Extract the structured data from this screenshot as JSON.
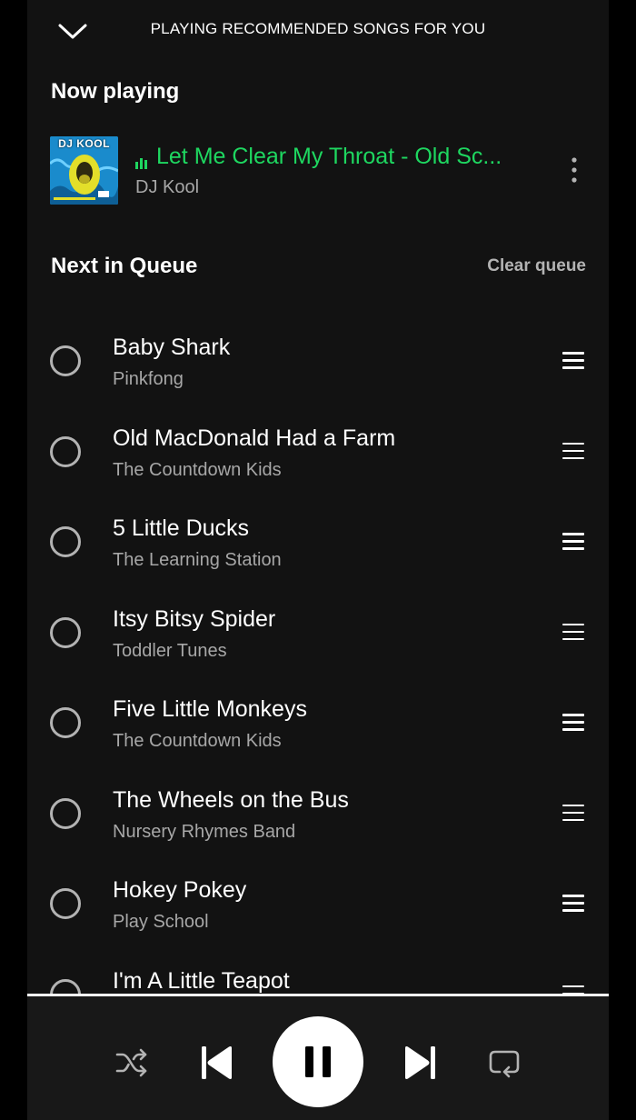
{
  "header": {
    "title": "PLAYING RECOMMENDED SONGS FOR YOU",
    "collapse_icon": "chevron-down-icon"
  },
  "now_playing": {
    "heading": "Now playing",
    "track": {
      "title": "Let Me Clear My Throat - Old Sc...",
      "artist": "DJ Kool",
      "art_text": "DJ KOOL",
      "playing_indicator_icon": "equalizer-icon",
      "more_icon": "more-vertical-icon"
    }
  },
  "queue": {
    "heading": "Next in Queue",
    "clear_label": "Clear queue",
    "items": [
      {
        "title": "Baby Shark",
        "artist": "Pinkfong"
      },
      {
        "title": "Old MacDonald Had a Farm",
        "artist": "The Countdown Kids"
      },
      {
        "title": "5 Little Ducks",
        "artist": "The Learning Station"
      },
      {
        "title": "Itsy Bitsy Spider",
        "artist": "Toddler Tunes"
      },
      {
        "title": "Five Little Monkeys",
        "artist": "The Countdown Kids"
      },
      {
        "title": "The Wheels on the Bus",
        "artist": "Nursery Rhymes Band"
      },
      {
        "title": "Hokey Pokey",
        "artist": "Play School"
      },
      {
        "title": "I'm A Little Teapot",
        "artist": ""
      }
    ]
  },
  "player": {
    "controls": [
      "shuffle-icon",
      "previous-icon",
      "pause-icon",
      "next-icon",
      "repeat-icon"
    ]
  },
  "colors": {
    "accent": "#1ed760",
    "background": "#121212",
    "text_primary": "#ffffff",
    "text_secondary": "#a7a7a7"
  }
}
